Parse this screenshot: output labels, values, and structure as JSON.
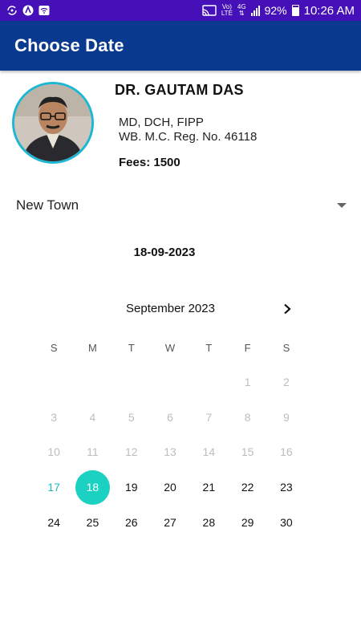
{
  "status_bar": {
    "battery": "92%",
    "time": "10:26 AM",
    "network_top": "Vo)",
    "network_bottom": "LTE",
    "data_type": "4G"
  },
  "app_bar": {
    "title": "Choose Date"
  },
  "doctor": {
    "name": "DR. GAUTAM DAS",
    "qualifications": "MD, DCH, FIPP",
    "registration": "WB. M.C. Reg. No. 46118",
    "fees": "Fees: 1500"
  },
  "location": {
    "selected": "New Town"
  },
  "selected_date": "18-09-2023",
  "calendar": {
    "month_title": "September 2023",
    "weekdays": [
      "S",
      "M",
      "T",
      "W",
      "T",
      "F",
      "S"
    ],
    "first_weekday_index": 5,
    "days_in_month": 30,
    "today": 17,
    "selected": 18
  },
  "colors": {
    "status_bar": "#4510b8",
    "app_bar": "#0a3a8f",
    "avatar_ring": "#1cb7d3",
    "selected_day": "#1ad1c2",
    "today_text": "#19b9c2"
  }
}
